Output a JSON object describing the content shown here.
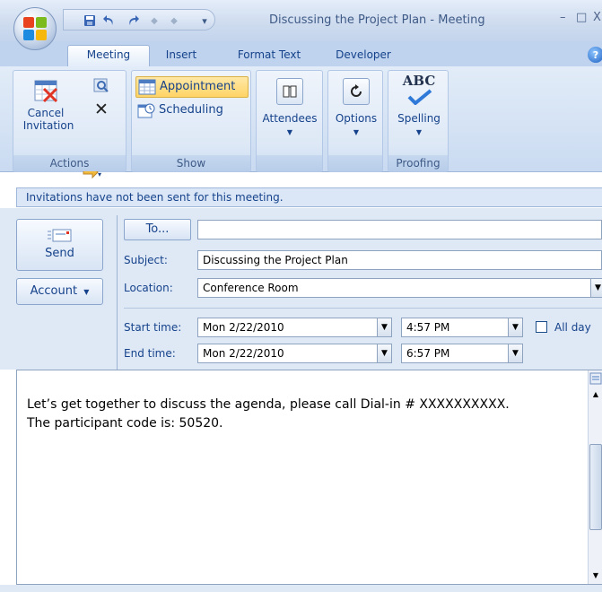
{
  "window": {
    "title": "Discussing the Project Plan - Meeting",
    "minimize": "–",
    "maximize": "□",
    "close": "X"
  },
  "qat": {
    "save": "💾",
    "undo": "↶",
    "redo": "↷",
    "prev": "◆",
    "next": "◆",
    "more": "▾"
  },
  "tabs": [
    "Meeting",
    "Insert",
    "Format Text",
    "Developer"
  ],
  "help": "?",
  "ribbon": {
    "actions": {
      "label": "Actions",
      "cancel_line1": "Cancel",
      "cancel_line2": "Invitation"
    },
    "show": {
      "label": "Show",
      "appointment": "Appointment",
      "scheduling": "Scheduling"
    },
    "attendees": {
      "label": "Attendees"
    },
    "options": {
      "label": "Options"
    },
    "proofing": {
      "label": "Proofing",
      "spelling": "Spelling",
      "abc": "ABC"
    }
  },
  "infobar": "Invitations have not been sent for this meeting.",
  "form": {
    "send": "Send",
    "account": "Account",
    "to_button": "To...",
    "to_value": "",
    "subject_label": "Subject:",
    "subject_value": "Discussing the Project Plan",
    "location_label": "Location:",
    "location_value": "Conference Room",
    "start_label": "Start time:",
    "start_date": "Mon 2/22/2010",
    "start_time": "4:57 PM",
    "end_label": "End time:",
    "end_date": "Mon 2/22/2010",
    "end_time": "6:57 PM",
    "allday_label": "All day",
    "allday_checked": false
  },
  "body": {
    "line1": "Let’s get together to discuss the agenda, please call Dial-in # XXXXXXXXXX.",
    "line2": "The participant code is: 50520."
  }
}
